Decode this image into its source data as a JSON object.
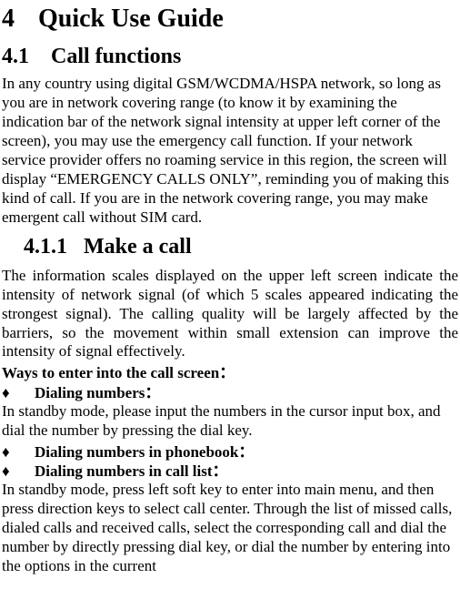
{
  "h1": {
    "num": "4",
    "title": "Quick Use Guide"
  },
  "h2": {
    "num": "4.1",
    "title": "Call functions"
  },
  "p1": "In any country using digital GSM/WCDMA/HSPA network, so long as you are in network covering range (to know it by examining the indication bar of the network signal intensity at upper left corner of the screen), you may use the emergency call function. If your network service provider offers no roaming service in this region, the screen will display “EMERGENCY CALLS ONLY”, reminding you of making this kind of call. If you are in the network covering range, you may make emergent call without SIM card.",
  "h3": {
    "num": "4.1.1",
    "title": "Make a call"
  },
  "p2": "The information scales displayed on the upper left screen indicate the intensity of network signal (of which 5 scales appeared indicating the strongest signal). The calling quality will be largely affected by the barriers, so the movement within small extension can improve the intensity of signal effectively.",
  "ways_label": "Ways to enter into the call screen：",
  "bullets": {
    "sym": "♦",
    "b1": "Dialing numbers：",
    "b2": "Dialing numbers in phonebook：",
    "b3": "Dialing numbers in call list："
  },
  "p3": "In standby mode, please input the numbers in the cursor input box, and dial the number by pressing the dial key.",
  "p4": "In standby mode, press left soft key to enter into main menu, and then press direction keys to select call center. Through the list of missed calls, dialed calls and received calls, select the corresponding call and dial the number by directly pressing dial key, or dial the number by entering into the options in the current"
}
